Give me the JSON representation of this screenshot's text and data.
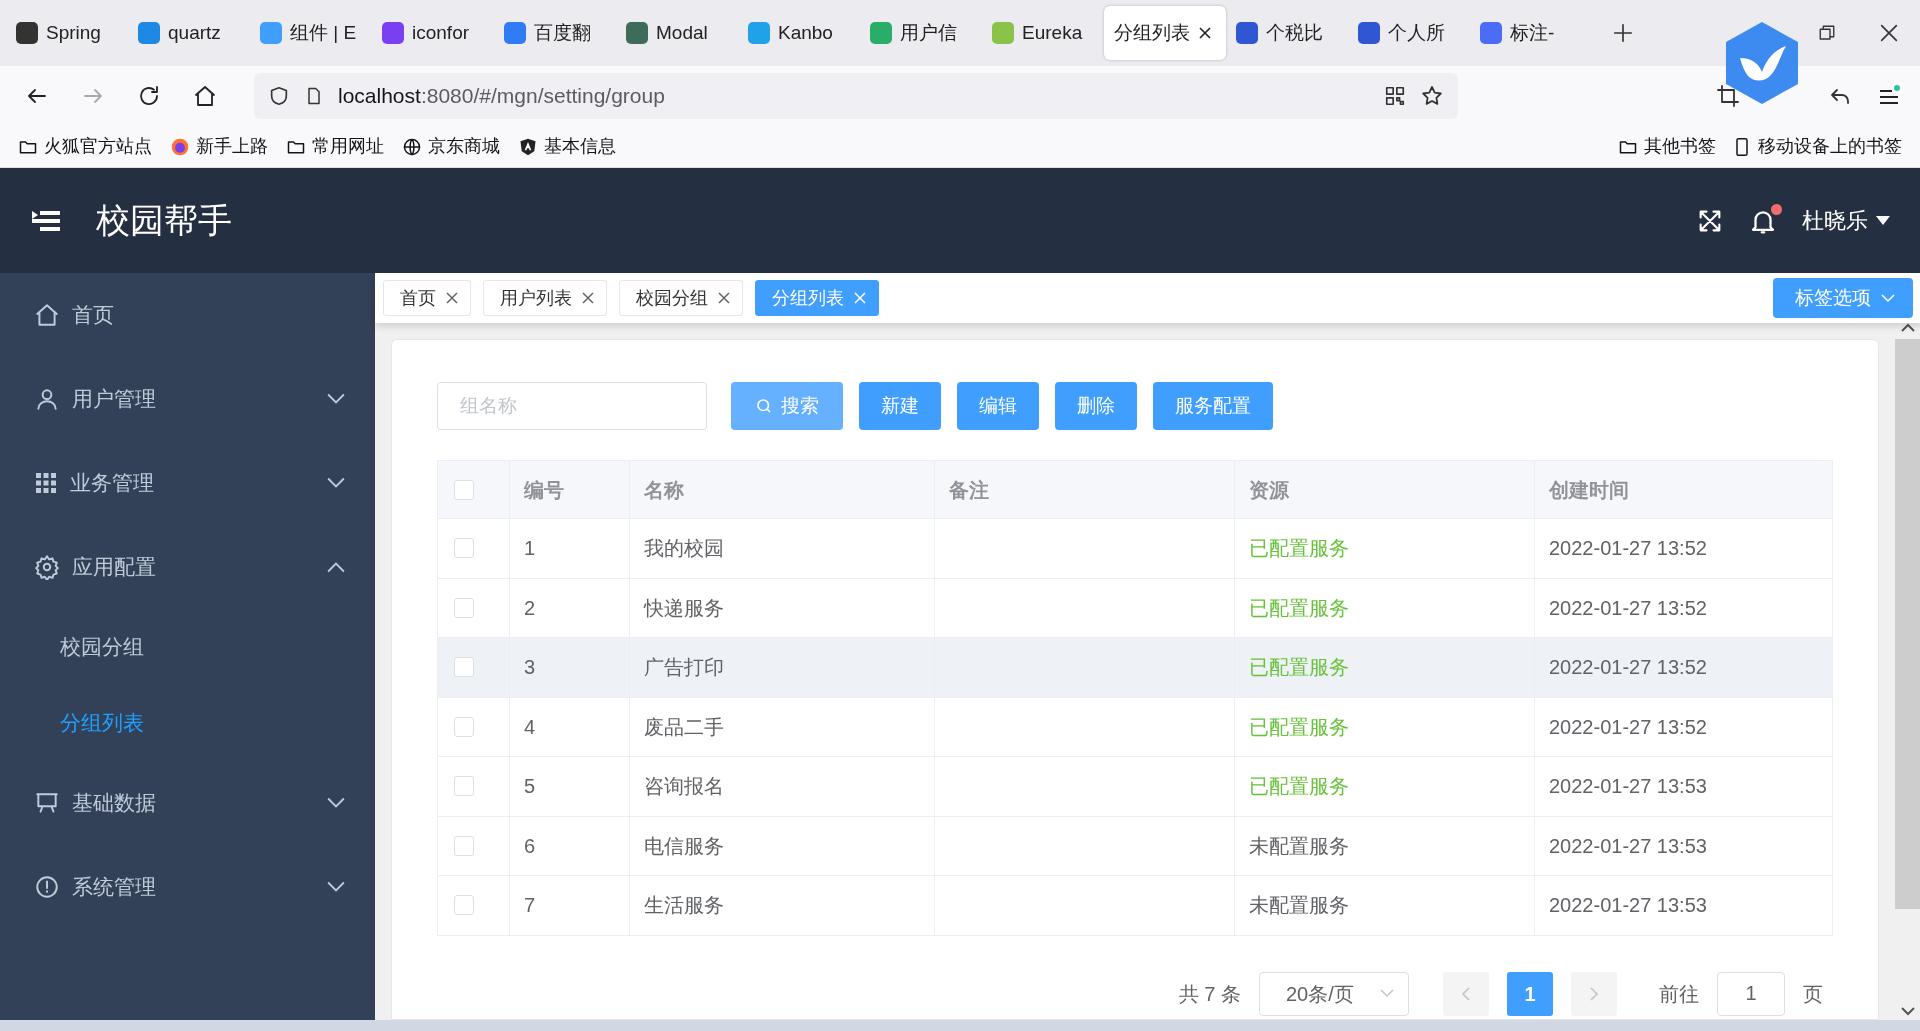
{
  "browser": {
    "tabs": [
      {
        "label": "Spring",
        "selected": false
      },
      {
        "label": "quartz",
        "selected": false
      },
      {
        "label": "组件 | E",
        "selected": false
      },
      {
        "label": "iconfor",
        "selected": false
      },
      {
        "label": "百度翻",
        "selected": false
      },
      {
        "label": "Modal",
        "selected": false
      },
      {
        "label": "Kanbo",
        "selected": false
      },
      {
        "label": "用户信",
        "selected": false
      },
      {
        "label": "Eureka",
        "selected": false
      },
      {
        "label": "分组列表",
        "selected": true
      },
      {
        "label": "个税比",
        "selected": false
      },
      {
        "label": "个人所",
        "selected": false
      },
      {
        "label": "标注-",
        "selected": false
      }
    ],
    "url": {
      "host": "localhost",
      "path": ":8080/#/mgn/setting/group"
    },
    "bookmarks": [
      {
        "label": "火狐官方站点",
        "kind": "folder"
      },
      {
        "label": "新手上路",
        "kind": "firefox"
      },
      {
        "label": "常用网址",
        "kind": "folder"
      },
      {
        "label": "京东商城",
        "kind": "globe"
      },
      {
        "label": "基本信息",
        "kind": "angular"
      }
    ],
    "bookmarks_right": [
      {
        "label": "其他书签",
        "kind": "folder"
      },
      {
        "label": "移动设备上的书签",
        "kind": "phone"
      }
    ]
  },
  "app": {
    "title": "校园帮手",
    "user": "杜晓乐",
    "unread": true,
    "sidebar": [
      {
        "label": "首页",
        "kind": "link"
      },
      {
        "label": "用户管理",
        "kind": "menu",
        "expanded": false
      },
      {
        "label": "业务管理",
        "kind": "menu",
        "expanded": false
      },
      {
        "label": "应用配置",
        "kind": "menu",
        "expanded": true,
        "children": [
          {
            "label": "校园分组",
            "selected": false
          },
          {
            "label": "分组列表",
            "selected": true
          }
        ]
      },
      {
        "label": "基础数据",
        "kind": "menu",
        "expanded": false
      },
      {
        "label": "系统管理",
        "kind": "menu",
        "expanded": false
      }
    ],
    "tags": [
      {
        "label": "首页",
        "selected": false
      },
      {
        "label": "用户列表",
        "selected": false
      },
      {
        "label": "校园分组",
        "selected": false
      },
      {
        "label": "分组列表",
        "selected": true
      }
    ],
    "tag_options": "标签选项",
    "search": {
      "placeholder": "组名称"
    },
    "buttons": [
      {
        "label": "搜索",
        "kind": "search"
      },
      {
        "label": "新建",
        "kind": "primary"
      },
      {
        "label": "编辑",
        "kind": "primary"
      },
      {
        "label": "删除",
        "kind": "primary"
      },
      {
        "label": "服务配置",
        "kind": "primary"
      }
    ],
    "table": {
      "header_checked": false,
      "columns": [
        "编号",
        "名称",
        "备注",
        "资源",
        "创建时间"
      ],
      "rows": [
        {
          "id": "1",
          "name": "我的校园",
          "resource": "已配置服务",
          "configured": true,
          "created": "2022-01-27 13:52",
          "checked": false,
          "selected": false
        },
        {
          "id": "2",
          "name": "快递服务",
          "resource": "已配置服务",
          "configured": true,
          "created": "2022-01-27 13:52",
          "checked": false,
          "selected": false
        },
        {
          "id": "3",
          "name": "广告打印",
          "resource": "已配置服务",
          "configured": true,
          "created": "2022-01-27 13:52",
          "checked": false,
          "selected": true
        },
        {
          "id": "4",
          "name": "废品二手",
          "resource": "已配置服务",
          "configured": true,
          "created": "2022-01-27 13:52",
          "checked": false,
          "selected": false
        },
        {
          "id": "5",
          "name": "咨询报名",
          "resource": "已配置服务",
          "configured": true,
          "created": "2022-01-27 13:53",
          "checked": false,
          "selected": false
        },
        {
          "id": "6",
          "name": "电信服务",
          "resource": "未配置服务",
          "configured": false,
          "created": "2022-01-27 13:53",
          "checked": false,
          "selected": false
        },
        {
          "id": "7",
          "name": "生活服务",
          "resource": "未配置服务",
          "configured": false,
          "created": "2022-01-27 13:53",
          "checked": false,
          "selected": false
        }
      ]
    },
    "pagination": {
      "total": "共 7 条",
      "page_size": "20条/页",
      "prev_disabled": true,
      "next_disabled": true,
      "pages": [
        {
          "label": "1",
          "selected": true
        }
      ],
      "goto_label": "前往",
      "goto_value": "1",
      "page_unit": "页"
    }
  }
}
